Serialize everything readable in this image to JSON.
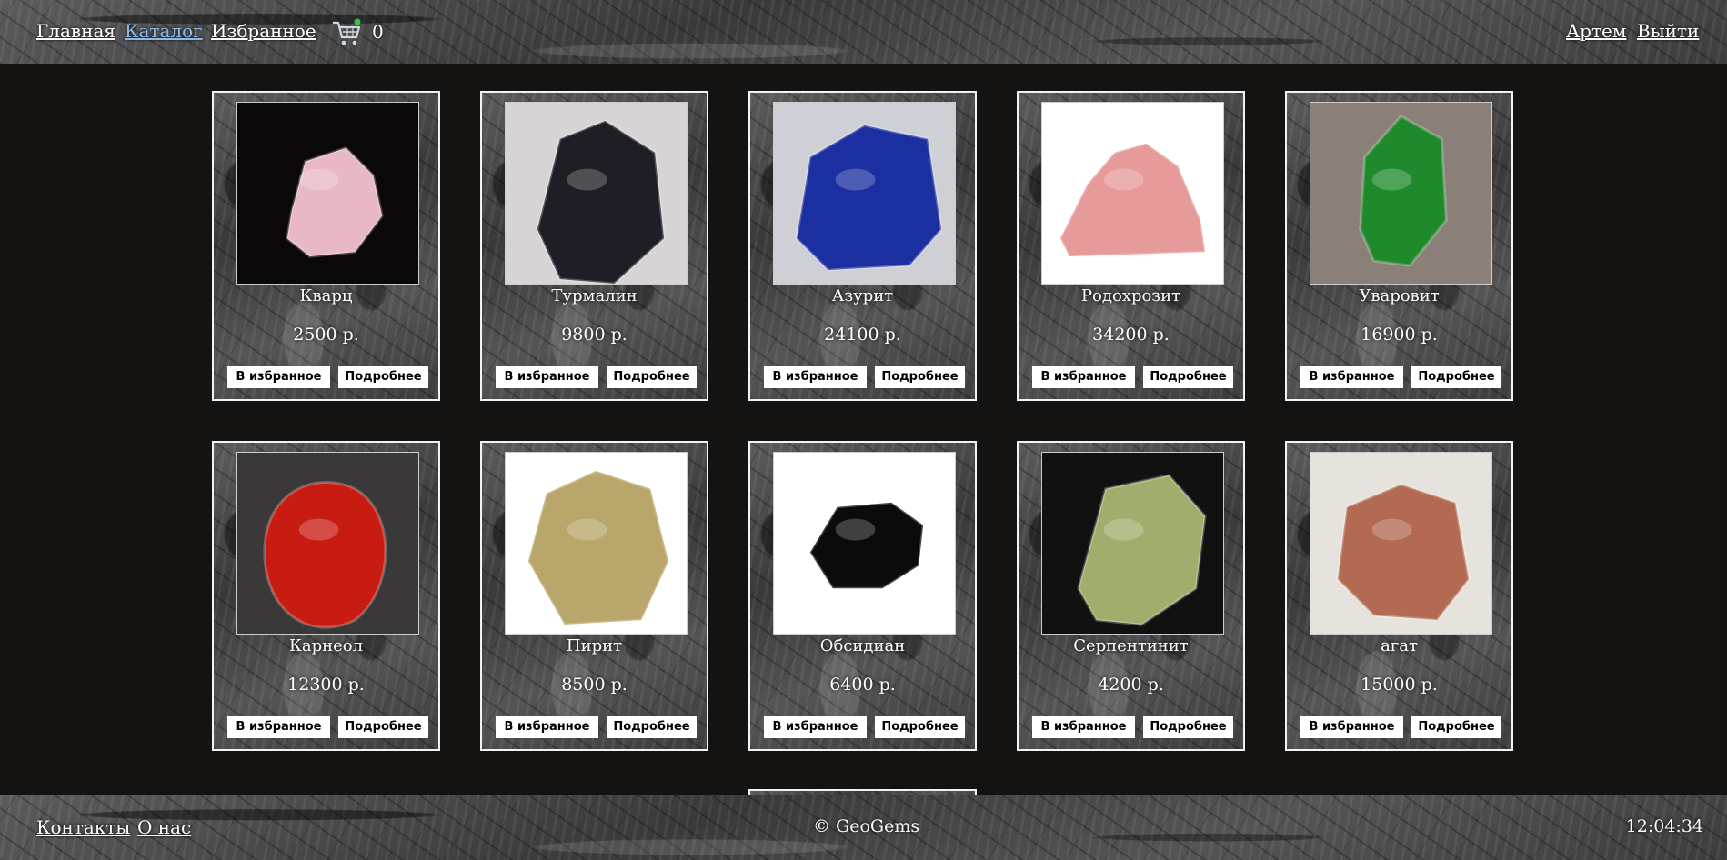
{
  "header": {
    "nav": [
      "Главная",
      "Каталог",
      "Избранное"
    ],
    "active_nav": "Каталог",
    "cart_icon": "shopping-cart-icon",
    "cart_count": "0",
    "user_name": "Артем",
    "logout_label": "Выйти"
  },
  "catalog": {
    "fav_label": "В избранное",
    "more_label": "Подробнее",
    "products": [
      {
        "name": "Кварц",
        "price": "2500 р.",
        "bg": "#0a0808",
        "stone": "#e8b9c4"
      },
      {
        "name": "Турмалин",
        "price": "9800 р.",
        "bg": "#d8d4d6",
        "stone": "#1e1e24"
      },
      {
        "name": "Азурит",
        "price": "24100 р.",
        "bg": "#cfcfd6",
        "stone": "#1c2fa0"
      },
      {
        "name": "Родохрозит",
        "price": "34200 р.",
        "bg": "#ffffff",
        "stone": "#e79a9a"
      },
      {
        "name": "Уваровит",
        "price": "16900 р.",
        "bg": "#8a8078",
        "stone": "#1f8a2c"
      },
      {
        "name": "Карнеол",
        "price": "12300 р.",
        "bg": "#3a3838",
        "stone": "#c81c12"
      },
      {
        "name": "Пирит",
        "price": "8500 р.",
        "bg": "#ffffff",
        "stone": "#b8a66a"
      },
      {
        "name": "Обсидиан",
        "price": "6400 р.",
        "bg": "#ffffff",
        "stone": "#0b0b0b"
      },
      {
        "name": "Серпентинит",
        "price": "4200 р.",
        "bg": "#111111",
        "stone": "#9fae6c"
      },
      {
        "name": "агат",
        "price": "15000 р.",
        "bg": "#e6e2de",
        "stone": "#b36a52"
      }
    ]
  },
  "footer": {
    "links": [
      "Контакты",
      "О нас"
    ],
    "copyright": "© GeoGems",
    "time": "12:04:34"
  }
}
